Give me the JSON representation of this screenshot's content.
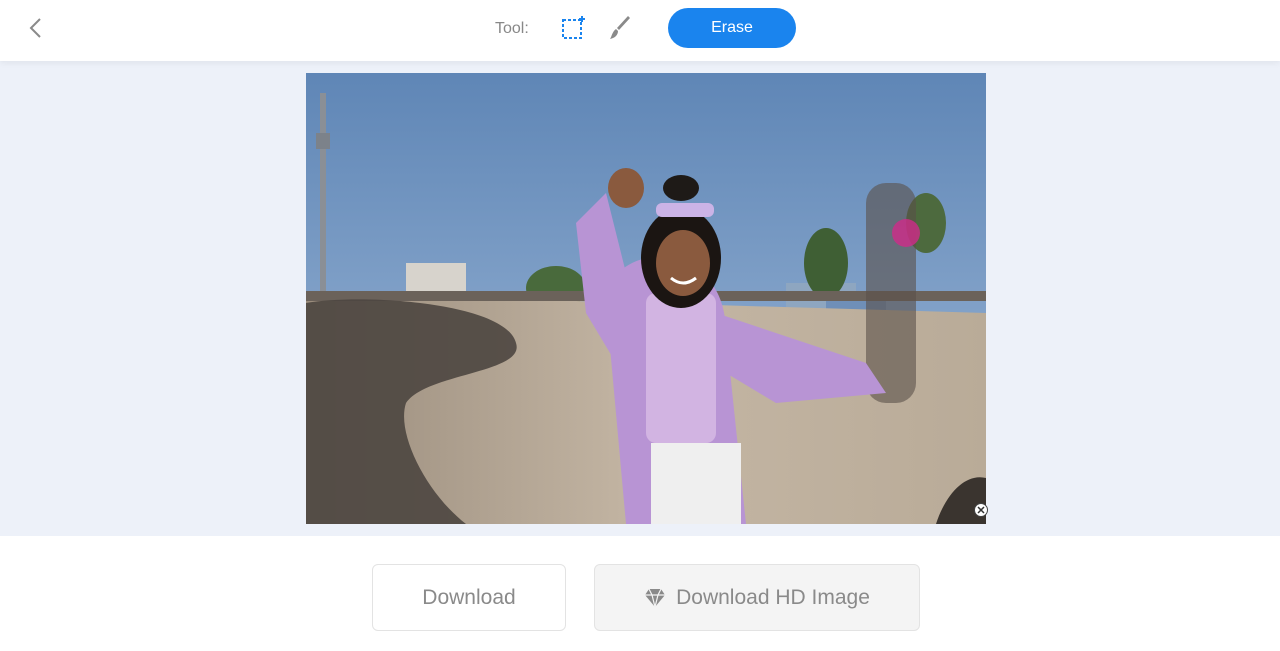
{
  "toolbar": {
    "back_icon": "chevron-left-icon",
    "tool_label": "Tool:",
    "tools": [
      {
        "name": "rectangle-select-icon",
        "active": true
      },
      {
        "name": "brush-icon",
        "active": false
      }
    ],
    "erase_label": "Erase"
  },
  "canvas": {
    "image_subject": "woman in lilac jacket and sunglasses on head dancing at skatepark",
    "remove_icon": "close-circle-icon"
  },
  "actions": {
    "download_label": "Download",
    "download_hd_label": "Download HD Image",
    "hd_icon": "diamond-icon"
  },
  "colors": {
    "accent": "#1a84ee",
    "canvas_bg": "#edf1f9",
    "muted_text": "#8a8a8a"
  }
}
